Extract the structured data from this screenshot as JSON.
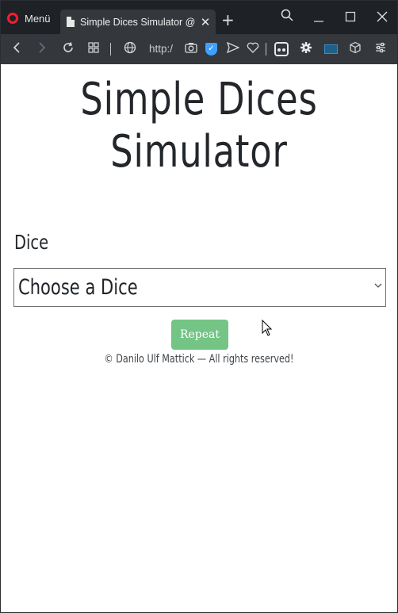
{
  "browser": {
    "menu_label": "Menü",
    "tab_title": "Simple Dices Simulator @ d",
    "new_tab": "+",
    "url": "http:/"
  },
  "icons": {
    "back": "chevron-left-icon",
    "forward": "chevron-right-icon",
    "reload": "reload-icon",
    "speed_dial": "grid-icon",
    "globe": "globe-icon",
    "camera": "camera-icon",
    "shield": "shield-check-icon",
    "send": "send-icon",
    "heart": "heart-icon",
    "extension": "extension-icon",
    "settings": "gear-icon",
    "cube": "cube-icon",
    "easy_setup": "sliders-icon"
  },
  "page": {
    "heading": "Simple Dices Simulator",
    "dice_label": "Dice",
    "select_value": "Choose a Dice",
    "repeat_label": "Repeat",
    "footer": "© Danilo Ulf Mattick — All rights reserved!"
  },
  "colors": {
    "repeat_button": "#74c485",
    "opera_red": "#ff1b2d",
    "shield_blue": "#3fa0ff"
  }
}
